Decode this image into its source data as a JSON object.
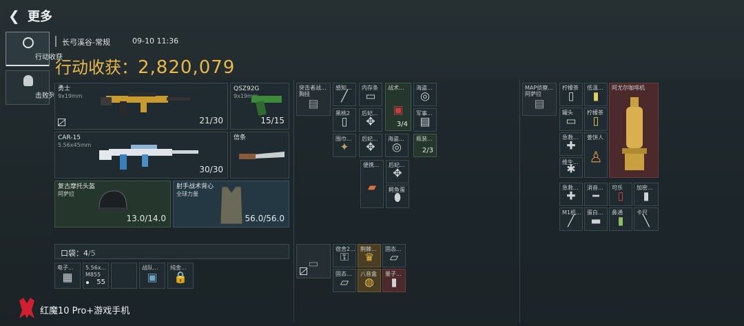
{
  "header": {
    "back_label": "更多"
  },
  "sidebar": {
    "tabs": [
      {
        "label": "行动收获"
      },
      {
        "label": "击败列表"
      }
    ]
  },
  "session": {
    "map": "长弓溪谷-常规",
    "datetime": "09-10 11:36",
    "earnings_label": "行动收获：",
    "earnings_value": "2,820,079"
  },
  "weapons": {
    "primary": {
      "name": "勇士",
      "caliber": "9x19mm",
      "ammo": "21/30"
    },
    "pistol": {
      "name": "QSZ92G",
      "caliber": "9x19mm",
      "ammo": "15/15"
    },
    "secondary": {
      "name": "CAR-15",
      "caliber": "5.56x45mm",
      "ammo": "30/30"
    },
    "melee": {
      "name": "信条"
    }
  },
  "armor": {
    "helmet": {
      "name": "复古摩托头盔",
      "sub": "阿萨拉",
      "durability": "13.0/14.0"
    },
    "vest": {
      "name": "射手战术背心",
      "sub": "全球力量",
      "durability": "56.0/56.0"
    }
  },
  "pocket": {
    "label": "口袋：",
    "used": "4",
    "capacity": "/5",
    "items": [
      {
        "label": "电子...",
        "icon": "device-icon"
      },
      {
        "label": "5.56x...",
        "sub": "M855",
        "count": "55",
        "icon": "ammo-icon"
      },
      {
        "label": "",
        "icon": ""
      },
      {
        "label": "战队...",
        "icon": "photo-icon"
      },
      {
        "label": "纯金...",
        "icon": "gold-lock-icon"
      }
    ]
  },
  "rig": {
    "item": {
      "label": "突击者战术胸挂",
      "short": "突击者战...",
      "short2": "胸挂"
    },
    "items": [
      {
        "label": "感知...",
        "icon": "syringe-icon"
      },
      {
        "label": "内存条",
        "icon": "chip-icon"
      },
      {
        "label": "战术...",
        "icon": "medkit-icon",
        "count": "3/4"
      },
      {
        "label": "海盗...",
        "icon": "coin-icon"
      },
      {
        "label": "黑桃2",
        "icon": "card-icon"
      },
      {
        "label": "后妃...",
        "icon": "jewel-icon"
      },
      {
        "label": "军事...",
        "icon": "map-icon"
      },
      {
        "label": "围巾...",
        "icon": "scarf-icon"
      },
      {
        "label": "后妃...",
        "icon": "jewel-icon"
      },
      {
        "label": "海盗...",
        "icon": "coin-icon"
      },
      {
        "label": "瓶装...",
        "icon": "bottle-icon",
        "count": "2/3"
      },
      {
        "label": "便携...",
        "icon": "bag-icon"
      },
      {
        "label": "后妃...",
        "icon": "jewel-icon"
      },
      {
        "label": "鳄鱼蛋",
        "icon": "egg-icon"
      }
    ]
  },
  "case": {
    "items": [
      {
        "label": "宿舍2...",
        "icon": "key-icon"
      },
      {
        "label": "荆棘...",
        "icon": "trophy-icon"
      },
      {
        "label": "固态...",
        "icon": "drive-icon"
      },
      {
        "label": "固态...",
        "icon": "drive-icon"
      },
      {
        "label": "八音盒",
        "icon": "musicbox-icon"
      },
      {
        "label": "量子...",
        "icon": "usb-icon"
      }
    ]
  },
  "backpack": {
    "item": {
      "label": "MAP侦察背包",
      "short": "MAP侦察...",
      "short2": "阿萨拉"
    },
    "items": [
      {
        "label": "柠檬茶",
        "icon": "can-icon"
      },
      {
        "label": "低温...",
        "icon": "vial-icon"
      },
      {
        "label": "阿尤尔咖啡机",
        "icon": "coffee-machine-icon"
      },
      {
        "label": "罐头",
        "icon": "tin-icon"
      },
      {
        "label": "柠檬茶",
        "icon": "can-icon"
      },
      {
        "label": "急救...",
        "icon": "firstaid-icon"
      },
      {
        "label": "姜饼人",
        "icon": "gingerbread-icon"
      },
      {
        "label": "维生...",
        "icon": "pill-icon"
      },
      {
        "label": "急救...",
        "icon": "firstaid-icon"
      },
      {
        "label": "消音...",
        "icon": "suppressor-icon"
      },
      {
        "label": "可乐",
        "icon": "cola-icon"
      },
      {
        "label": "加密...",
        "icon": "phone-icon"
      },
      {
        "label": "M1机...",
        "icon": "part-icon"
      },
      {
        "label": "蛋白...",
        "icon": "protein-icon"
      },
      {
        "label": "鼻通",
        "icon": "spray-icon"
      },
      {
        "label": "卡尺",
        "icon": "caliper-icon"
      }
    ]
  },
  "watermark": {
    "text": "红魔10 Pro+游戏手机"
  },
  "colors": {
    "accent_gold": "#e8b84a",
    "bg": "#263033"
  }
}
